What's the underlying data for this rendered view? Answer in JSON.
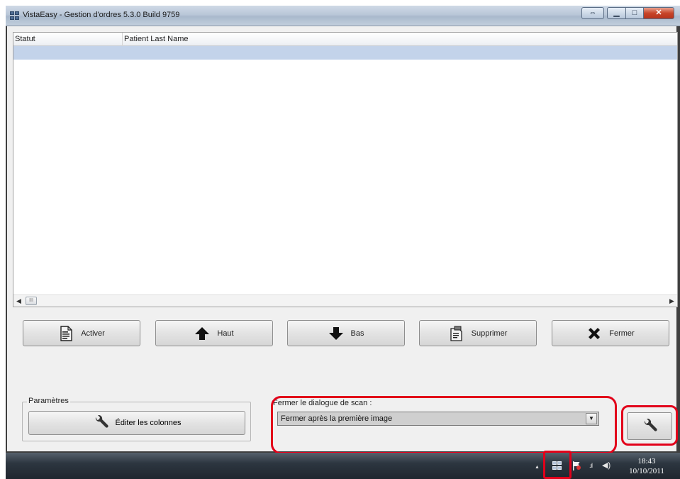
{
  "window": {
    "title": "VistaEasy - Gestion d'ordres 5.3.0 Build 9759"
  },
  "grid": {
    "columns": [
      "Statut",
      "Patient Last Name"
    ]
  },
  "actions": [
    {
      "label": "Activer",
      "icon": "document-activate-icon"
    },
    {
      "label": "Haut",
      "icon": "arrow-up-icon"
    },
    {
      "label": "Bas",
      "icon": "arrow-down-icon"
    },
    {
      "label": "Supprimer",
      "icon": "trash-icon"
    },
    {
      "label": "Fermer",
      "icon": "close-x-icon"
    }
  ],
  "parametres": {
    "legend": "Paramètres",
    "edit_columns_label": "Éditer les colonnes",
    "icon": "wrench-icon"
  },
  "scan_close": {
    "legend": "Fermer le dialogue de scan :",
    "selected": "Fermer après la première image"
  },
  "settings_button": {
    "icon": "wrench-icon"
  },
  "taskbar": {
    "time": "18:43",
    "date": "10/10/2011"
  },
  "colors": {
    "highlight": "#e2001a",
    "selection": "#c3d3ea"
  }
}
